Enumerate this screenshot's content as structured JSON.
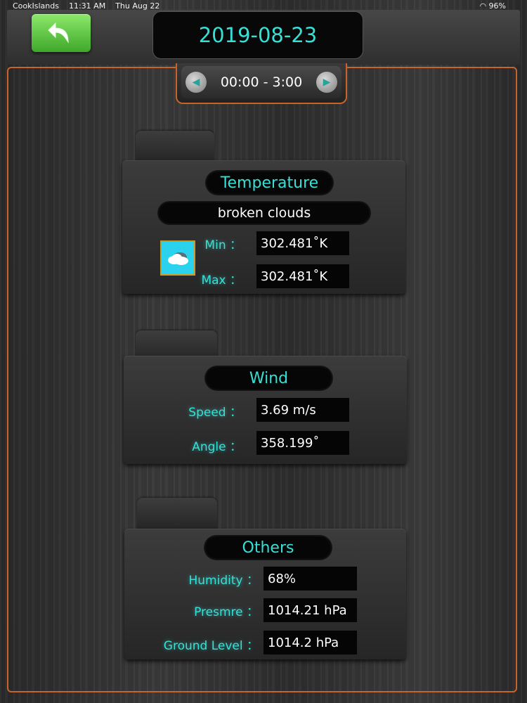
{
  "status": {
    "carrier": "CookIslands",
    "time": "11:31 AM",
    "date": "Thu Aug 22",
    "battery": "96%"
  },
  "header": {
    "date": "2019-08-23",
    "back_icon": "back-arrow-icon"
  },
  "time_range": {
    "label": "00:00 - 3:00"
  },
  "temperature": {
    "title": "Temperature",
    "description": "broken clouds",
    "min_label": "Min ：",
    "min_value": "302.481˚K",
    "max_label": "Max ：",
    "max_value": "302.481˚K",
    "icon": "cloud-icon"
  },
  "wind": {
    "title": "Wind",
    "speed_label": "Speed ：",
    "speed_value": "3.69 m/s",
    "angle_label": "Angle ：",
    "angle_value": "358.199˚"
  },
  "others": {
    "title": "Others",
    "humidity_label": "Humidity ：",
    "humidity_value": "68%",
    "pressure_label": "Presmre ：",
    "pressure_value": "1014.21 hPa",
    "ground_label": "Ground Level ：",
    "ground_value": "1014.2 hPa"
  },
  "colors": {
    "accent": "#37e0d6",
    "frame": "#c8642a",
    "button": "#5cc43c"
  }
}
